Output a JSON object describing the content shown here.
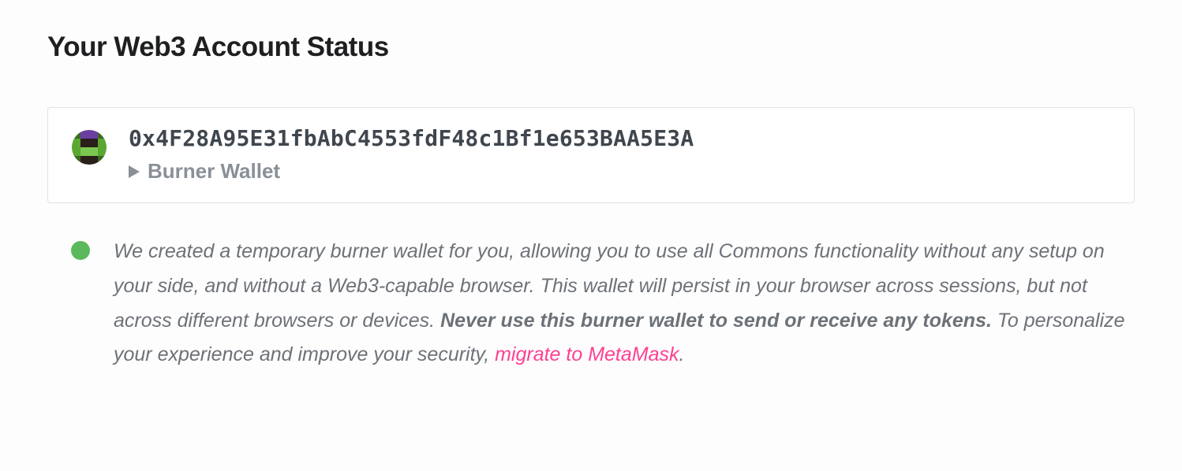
{
  "header": {
    "title": "Your Web3 Account Status"
  },
  "account": {
    "address": "0x4F28A95E31fbAbC4553fdF48c1Bf1e653BAA5E3A",
    "type_label": "Burner Wallet"
  },
  "status": {
    "indicator_color": "#5cb85c",
    "text_part1": "We created a temporary burner wallet for you, allowing you to use all Commons functionality without any setup on your side, and without a Web3-capable browser. This wallet will persist in your browser across sessions, but not across different browsers or devices. ",
    "bold_part": "Never use this burner wallet to send or receive any tokens.",
    "text_part2": " To personalize your experience and improve your security, ",
    "link_text": "migrate to MetaMask",
    "text_part3": "."
  }
}
